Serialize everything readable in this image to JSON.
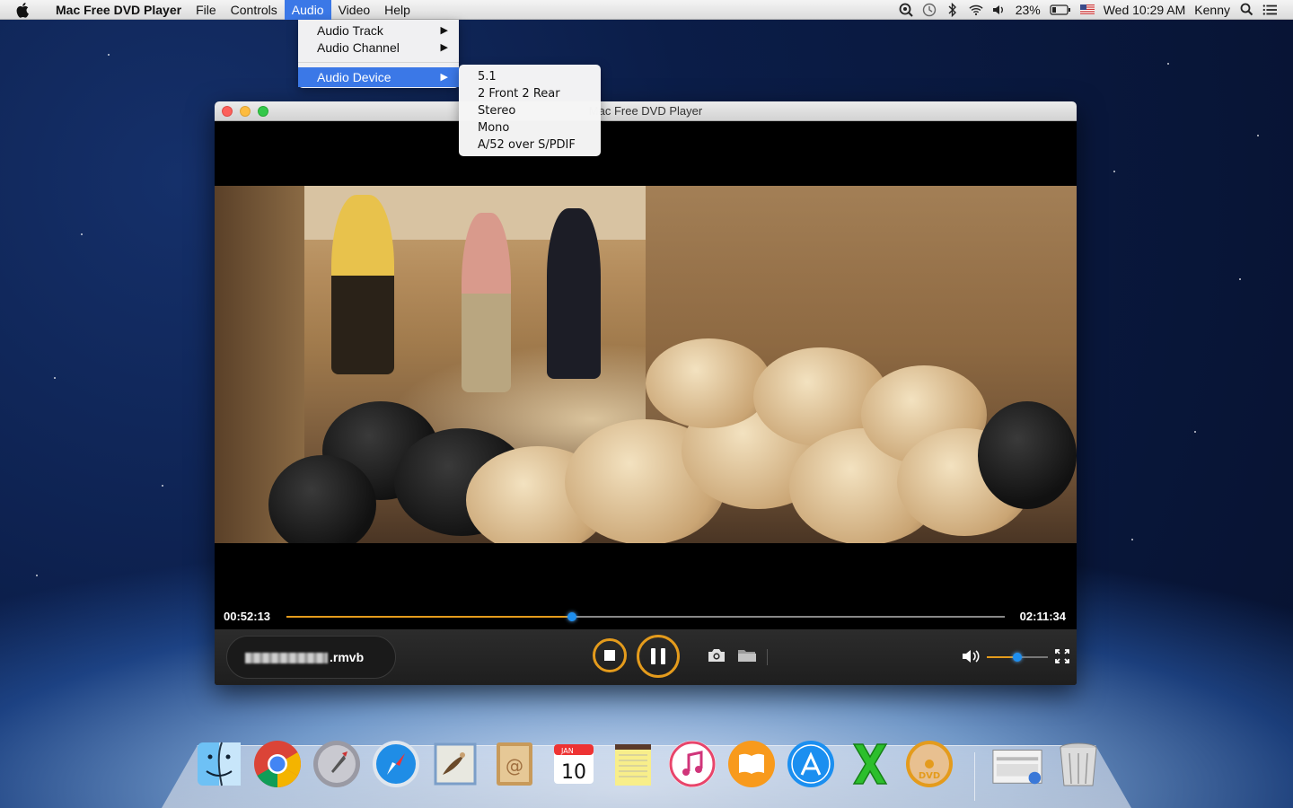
{
  "menubar": {
    "app_name": "Mac Free DVD Player",
    "menus": [
      "File",
      "Controls",
      "Audio",
      "Video",
      "Help"
    ],
    "active_menu": "Audio",
    "battery": "23%",
    "clock": "Wed 10:29 AM",
    "user": "Kenny"
  },
  "audio_menu": {
    "items": [
      {
        "label": "Audio Track",
        "has_submenu": true
      },
      {
        "label": "Audio Channel",
        "has_submenu": true
      },
      {
        "label": "Audio Device",
        "has_submenu": true,
        "highlighted": true
      }
    ]
  },
  "audio_device_submenu": {
    "items": [
      "5.1",
      "2 Front 2 Rear",
      "Stereo",
      "Mono",
      "A/52 over S/PDIF"
    ]
  },
  "window": {
    "title": "Mac Free DVD Player"
  },
  "player": {
    "current_time": "00:52:13",
    "total_time": "02:11:34",
    "progress": 0.397,
    "file_extension": ".rmvb",
    "volume": 0.5,
    "accent_color": "#e49b1c",
    "knob_color": "#1e8ff0"
  },
  "dock": {
    "items": [
      "finder-icon",
      "chrome-icon",
      "launchpad-icon",
      "safari-icon",
      "mail-icon",
      "contacts-icon",
      "calendar-icon",
      "notes-icon",
      "itunes-icon",
      "ibooks-icon",
      "app-store-icon",
      "x-app-icon",
      "dvd-player-icon",
      "preview-icon",
      "trash-icon"
    ],
    "calendar_month": "JAN",
    "calendar_day": "10"
  }
}
